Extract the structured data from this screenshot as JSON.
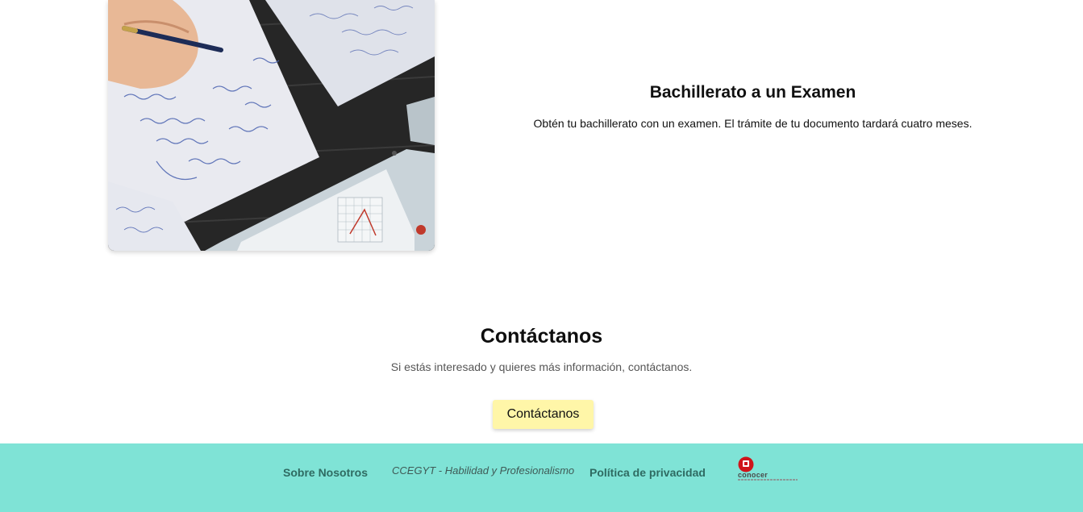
{
  "feature": {
    "title": "Bachillerato a un Examen",
    "description": "Obtén tu bachillerato con un examen. El trámite de tu documento tardará cuatro meses."
  },
  "contact": {
    "title": "Contáctanos",
    "description": "Si estás interesado y quieres más información, contáctanos.",
    "button_label": "Contáctanos"
  },
  "footer": {
    "about_label": "Sobre Nosotros",
    "tagline": "CCEGYT - Habilidad y Profesionalismo",
    "privacy_label": "Política de privacidad",
    "logo_text": "conocer"
  },
  "colors": {
    "footer_bg": "#7fe3d6",
    "button_bg": "#fff6a8",
    "footer_text": "#2f6b62",
    "logo_red": "#d0151b"
  }
}
